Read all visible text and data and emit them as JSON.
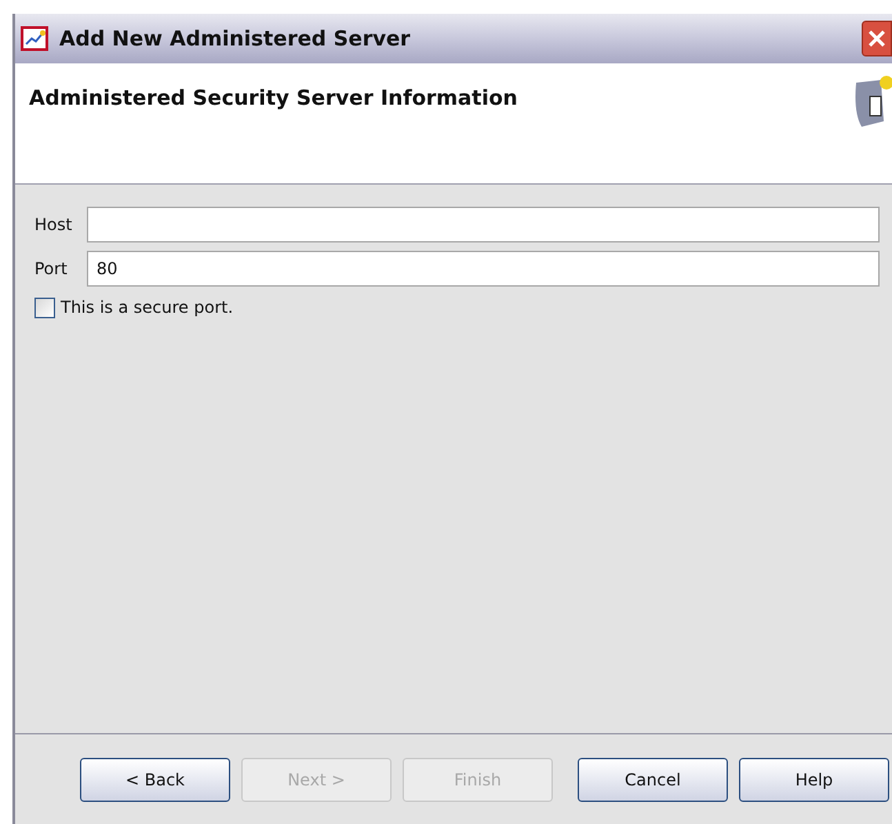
{
  "window": {
    "title": "Add New Administered Server"
  },
  "header": {
    "title": "Administered Security Server Information"
  },
  "fields": [
    {
      "label": "Host"
    },
    {
      "label": "Port",
      "value": "80"
    }
  ],
  "secure_port": {
    "label": "This is a secure port.",
    "checked": false
  },
  "buttons": [
    {
      "label": "< Back",
      "disabled": false
    },
    {
      "label": "Next >",
      "disabled": true
    },
    {
      "label": "Finish",
      "disabled": true
    },
    {
      "label": "Cancel",
      "disabled": false
    },
    {
      "label": "Help",
      "disabled": false
    }
  ]
}
